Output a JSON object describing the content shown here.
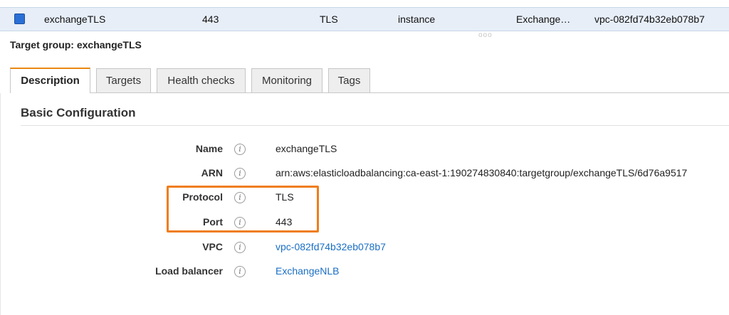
{
  "row": {
    "name": "exchangeTLS",
    "port": "443",
    "protocol": "TLS",
    "target_type": "instance",
    "load_balancer": "Exchange…",
    "vpc": "vpc-082fd74b32eb078b7"
  },
  "drag_handle": "ooo",
  "target_group_title": "Target group: exchangeTLS",
  "tabs": [
    {
      "label": "Description"
    },
    {
      "label": "Targets"
    },
    {
      "label": "Health checks"
    },
    {
      "label": "Monitoring"
    },
    {
      "label": "Tags"
    }
  ],
  "section_title": "Basic Configuration",
  "info_glyph": "i",
  "details": {
    "name": {
      "label": "Name",
      "value": "exchangeTLS"
    },
    "arn": {
      "label": "ARN",
      "value": "arn:aws:elasticloadbalancing:ca-east-1:190274830840:targetgroup/exchangeTLS/6d76a9517"
    },
    "protocol": {
      "label": "Protocol",
      "value": "TLS"
    },
    "port": {
      "label": "Port",
      "value": "443"
    },
    "vpc": {
      "label": "VPC",
      "value": "vpc-082fd74b32eb078b7"
    },
    "load_balancer": {
      "label": "Load balancer",
      "value": "ExchangeNLB"
    }
  },
  "colors": {
    "active_tab_accent": "#e8880f",
    "highlight_box": "#f07d1a",
    "link": "#1a6fc4",
    "selected_row": "#e7eef8"
  }
}
